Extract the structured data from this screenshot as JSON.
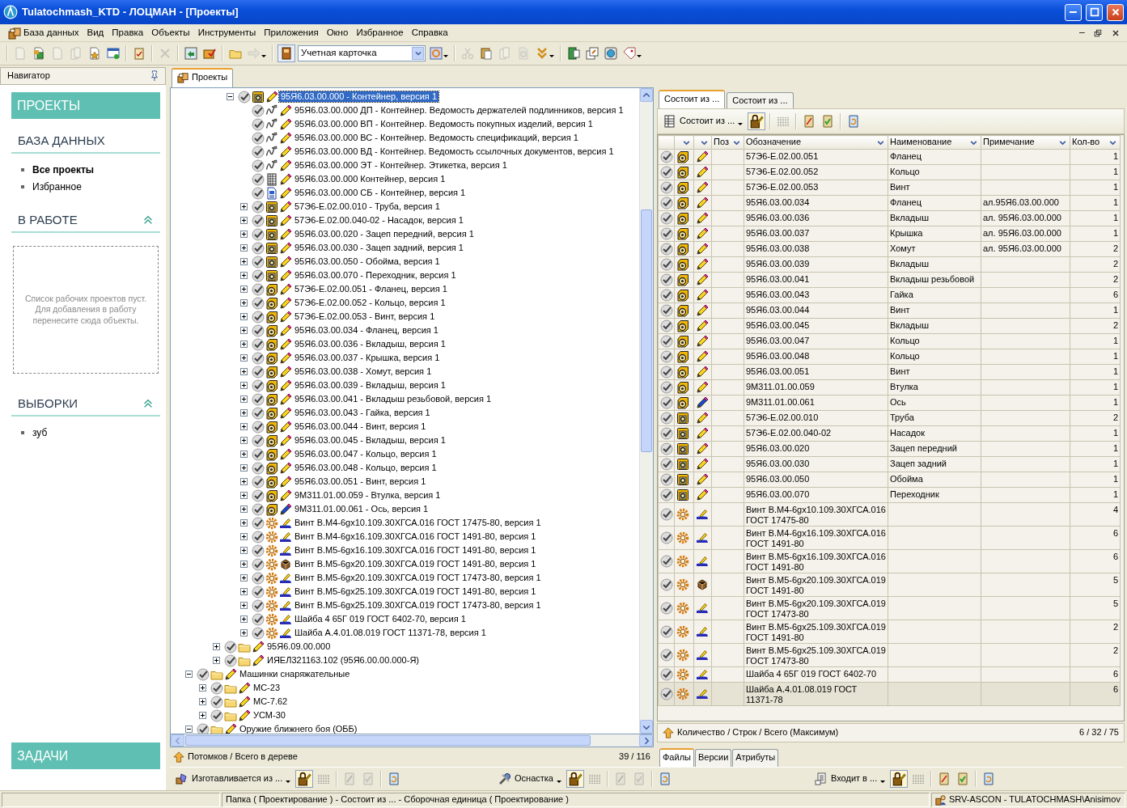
{
  "window": {
    "title": "Tulatochmash_KTD - ЛОЦМАН - [Проекты]"
  },
  "menu": [
    {
      "label": "База данных",
      "kind": "with-icon"
    },
    {
      "label": "Вид",
      "kind": "plain"
    },
    {
      "label": "Правка",
      "kind": "plain"
    },
    {
      "label": "Объекты",
      "kind": "plain"
    },
    {
      "label": "Инструменты",
      "kind": "plain"
    },
    {
      "label": "Приложения",
      "kind": "plain"
    },
    {
      "label": "Окно",
      "kind": "plain"
    },
    {
      "label": "Избранное",
      "kind": "plain"
    },
    {
      "label": "Справка",
      "kind": "plain"
    }
  ],
  "toolbar": [
    {
      "kind": "page",
      "disabled": true
    },
    {
      "kind": "pagecolor",
      "disabled": false
    },
    {
      "kind": "page",
      "disabled": true
    },
    {
      "kind": "pages",
      "disabled": true
    },
    {
      "kind": "geardoc",
      "disabled": false
    },
    {
      "kind": "winplus",
      "disabled": false
    },
    {
      "kind": "separator"
    },
    {
      "kind": "clip",
      "disabled": false
    },
    {
      "kind": "separator"
    },
    {
      "kind": "x",
      "disabled": true
    },
    {
      "kind": "separator"
    },
    {
      "kind": "imgarrow",
      "disabled": false
    },
    {
      "kind": "gearcheck",
      "disabled": false
    },
    {
      "kind": "separator"
    },
    {
      "kind": "folder",
      "disabled": false
    },
    {
      "kind": "go",
      "disabled": true,
      "dropdown": true
    },
    {
      "kind": "separator"
    },
    {
      "kind": "book",
      "disabled": false
    },
    {
      "kind": "combo",
      "value": "Учетная карточка"
    },
    {
      "kind": "cardrefresh",
      "disabled": false,
      "dropdown": true
    },
    {
      "kind": "separator"
    },
    {
      "kind": "scissors",
      "disabled": true
    },
    {
      "kind": "paste",
      "disabled": false
    },
    {
      "kind": "pages",
      "disabled": true
    },
    {
      "kind": "docsearch",
      "disabled": true
    },
    {
      "kind": "chevrons",
      "disabled": false,
      "dropdown": true
    },
    {
      "kind": "separator"
    },
    {
      "kind": "greendoor",
      "disabled": false
    },
    {
      "kind": "windows",
      "disabled": false
    },
    {
      "kind": "globe",
      "disabled": false
    },
    {
      "kind": "tag",
      "disabled": false,
      "dropdown": true
    }
  ],
  "navigator": {
    "title": "Навигатор",
    "sections": [
      {
        "kind": "banner",
        "title": "ПРОЕКТЫ"
      },
      {
        "kind": "heading",
        "title": "БАЗА ДАННЫХ",
        "collapsible": false,
        "items": [
          {
            "label": "Все проекты",
            "selected": true
          },
          {
            "label": "Избранное",
            "selected": false
          }
        ]
      },
      {
        "kind": "heading",
        "title": "В РАБОТЕ",
        "collapsible": true,
        "empty_text": "Список рабочих проектов пуст. Для добавления в работу перенесите сюда объекты."
      },
      {
        "kind": "heading",
        "title": "ВЫБОРКИ",
        "collapsible": true,
        "items": [
          {
            "label": "зуб",
            "selected": false
          }
        ]
      }
    ],
    "footer": "ЗАДАЧИ"
  },
  "tree": {
    "tabs": [
      {
        "label": "Проекты",
        "selected": true
      }
    ],
    "items": [
      {
        "children": [
          {
            "children": [
              {
                "children": [
                  {
                    "label": "95Я6.03.00.000 - Контейнер, версия 1",
                    "kind": "asm",
                    "expanded": true,
                    "selected": true,
                    "children": [
                      {
                        "label": "95Я6.03.00.000 ДП - Контейнер. Ведомость держателей подлинников, версия 1",
                        "kind": "sig",
                        "selected": false
                      },
                      {
                        "label": "95Я6.03.00.000 ВП - Контейнер. Ведомость покупных изделий, версия 1",
                        "kind": "sig",
                        "selected": false
                      },
                      {
                        "label": "95Я6.03.00.000 ВС - Контейнер. Ведомость спецификаций, версия 1",
                        "kind": "sig",
                        "selected": false
                      },
                      {
                        "label": "95Я6.03.00.000 ВД - Контейнер. Ведомость ссылочных документов, версия 1",
                        "kind": "sig",
                        "selected": false
                      },
                      {
                        "label": "95Я6.03.00.000 ЭТ - Контейнер. Этикетка, версия 1",
                        "kind": "sig",
                        "selected": false
                      },
                      {
                        "label": "95Я6.03.00.000 Контейнер, версия 1",
                        "kind": "spec",
                        "selected": false
                      },
                      {
                        "label": "95Я6.03.00.000 СБ - Контейнер, версия 1",
                        "kind": "drawing",
                        "selected": false
                      },
                      {
                        "label": "57Э6-Е.02.00.010 - Труба, версия 1",
                        "kind": "asm",
                        "expanded": false,
                        "selected": false
                      },
                      {
                        "label": "57Э6-Е.02.00.040-02 - Насадок, версия 1",
                        "kind": "asm",
                        "expanded": false,
                        "selected": false
                      },
                      {
                        "label": "95Я6.03.00.020 - Зацеп передний, версия 1",
                        "kind": "asm",
                        "expanded": false,
                        "selected": false
                      },
                      {
                        "label": "95Я6.03.00.030 - Зацеп задний, версия 1",
                        "kind": "asm",
                        "expanded": false,
                        "selected": false
                      },
                      {
                        "label": "95Я6.03.00.050 - Обойма, версия 1",
                        "kind": "asm",
                        "expanded": false,
                        "selected": false
                      },
                      {
                        "label": "95Я6.03.00.070 - Переходник, версия 1",
                        "kind": "asm",
                        "expanded": false,
                        "selected": false
                      },
                      {
                        "label": "57Э6-Е.02.00.051 - Фланец, версия 1",
                        "kind": "part",
                        "expanded": false,
                        "selected": false
                      },
                      {
                        "label": "57Э6-Е.02.00.052 - Кольцо, версия 1",
                        "kind": "part",
                        "expanded": false,
                        "selected": false
                      },
                      {
                        "label": "57Э6-Е.02.00.053 - Винт, версия 1",
                        "kind": "part",
                        "expanded": false,
                        "selected": false
                      },
                      {
                        "label": "95Я6.03.00.034 - Фланец, версия 1",
                        "kind": "part",
                        "expanded": false,
                        "selected": false
                      },
                      {
                        "label": "95Я6.03.00.036 - Вкладыш, версия 1",
                        "kind": "part",
                        "expanded": false,
                        "selected": false
                      },
                      {
                        "label": "95Я6.03.00.037 - Крышка, версия 1",
                        "kind": "part",
                        "expanded": false,
                        "selected": false
                      },
                      {
                        "label": "95Я6.03.00.038 - Хомут, версия 1",
                        "kind": "part",
                        "expanded": false,
                        "selected": false
                      },
                      {
                        "label": "95Я6.03.00.039 - Вкладыш, версия 1",
                        "kind": "part",
                        "expanded": false,
                        "selected": false
                      },
                      {
                        "label": "95Я6.03.00.041 - Вкладыш резьбовой, версия 1",
                        "kind": "part",
                        "expanded": false,
                        "selected": false
                      },
                      {
                        "label": "95Я6.03.00.043 - Гайка, версия 1",
                        "kind": "part",
                        "expanded": false,
                        "selected": false
                      },
                      {
                        "label": "95Я6.03.00.044 - Винт, версия 1",
                        "kind": "part",
                        "expanded": false,
                        "selected": false
                      },
                      {
                        "label": "95Я6.03.00.045 - Вкладыш, версия 1",
                        "kind": "part",
                        "expanded": false,
                        "selected": false
                      },
                      {
                        "label": "95Я6.03.00.047 - Кольцо, версия 1",
                        "kind": "part",
                        "expanded": false,
                        "selected": false
                      },
                      {
                        "label": "95Я6.03.00.048 - Кольцо, версия 1",
                        "kind": "part",
                        "expanded": false,
                        "selected": false
                      },
                      {
                        "label": "95Я6.03.00.051 - Винт, версия 1",
                        "kind": "part",
                        "expanded": false,
                        "selected": false
                      },
                      {
                        "label": "9М311.01.00.059 - Втулка, версия 1",
                        "kind": "part",
                        "expanded": false,
                        "selected": false
                      },
                      {
                        "label": "9М311.01.00.061 - Ось, версия 1",
                        "kind": "part-blue",
                        "expanded": false,
                        "selected": false
                      },
                      {
                        "label": "Винт В.М4-6gx10.109.30ХГСА.016 ГОСТ 17475-80, версия 1",
                        "kind": "std",
                        "expanded": false,
                        "selected": false
                      },
                      {
                        "label": "Винт В.М4-6gx16.109.30ХГСА.016 ГОСТ 1491-80, версия 1",
                        "kind": "std",
                        "expanded": false,
                        "selected": false
                      },
                      {
                        "label": "Винт В.М5-6gx16.109.30ХГСА.016 ГОСТ 1491-80, версия 1",
                        "kind": "std",
                        "expanded": false,
                        "selected": false
                      },
                      {
                        "label": "Винт В.М5-6gx20.109.30ХГСА.019 ГОСТ 1491-80, версия 1",
                        "kind": "std-cube",
                        "expanded": false,
                        "selected": false
                      },
                      {
                        "label": "Винт В.М5-6gx20.109.30ХГСА.019 ГОСТ 17473-80, версия 1",
                        "kind": "std",
                        "expanded": false,
                        "selected": false
                      },
                      {
                        "label": "Винт В.М5-6gx25.109.30ХГСА.019 ГОСТ 1491-80, версия 1",
                        "kind": "std",
                        "expanded": false,
                        "selected": false
                      },
                      {
                        "label": "Винт В.М5-6gx25.109.30ХГСА.019 ГОСТ 17473-80, версия 1",
                        "kind": "std",
                        "expanded": false,
                        "selected": false
                      },
                      {
                        "label": "Шайба 4 65Г 019 ГОСТ 6402-70, версия 1",
                        "kind": "std",
                        "expanded": false,
                        "selected": false
                      },
                      {
                        "label": "Шайба А.4.01.08.019 ГОСТ 11371-78, версия 1",
                        "kind": "std",
                        "expanded": false,
                        "selected": false
                      }
                    ]
                  }
                ]
              },
              {
                "label": "95Я6.09.00.000",
                "kind": "folder",
                "expanded": false,
                "selected": false
              },
              {
                "label": "ИЯЕЛ321163.102 (95Я6.00.00.000-Я)",
                "kind": "folder",
                "expanded": false,
                "selected": false
              }
            ]
          }
        ]
      },
      {
        "label": "Машинки снаряжательные",
        "kind": "folder",
        "expanded": true,
        "selected": false,
        "children": [
          {
            "label": "МС-23",
            "kind": "folder",
            "expanded": false,
            "selected": false
          },
          {
            "label": "МС-7.62",
            "kind": "folder",
            "expanded": false,
            "selected": false
          },
          {
            "label": "УСМ-30",
            "kind": "folder",
            "expanded": false,
            "selected": false
          }
        ]
      },
      {
        "label": "Оружие ближнего боя (ОББ)",
        "kind": "folder",
        "expanded": true,
        "selected": false
      }
    ],
    "status": {
      "label": "Потомков / Всего в дереве",
      "value": "39 / 116"
    }
  },
  "composition": {
    "tabs": [
      {
        "label": "Состоит из ...",
        "selected": true
      },
      {
        "label": "Состоит из ...",
        "selected": false
      }
    ],
    "view_button": "Состоит из ...",
    "columns": [
      "Поз",
      "Обозначение",
      "Наименование",
      "Примечание",
      "Кол-во"
    ],
    "rows": [
      {
        "kind": "part",
        "designation": "57Э6-Е.02.00.051",
        "name": "Фланец",
        "qty": "1",
        "selected": false
      },
      {
        "kind": "part",
        "designation": "57Э6-Е.02.00.052",
        "name": "Кольцо",
        "qty": "1",
        "selected": false
      },
      {
        "kind": "part",
        "designation": "57Э6-Е.02.00.053",
        "name": "Винт",
        "qty": "1",
        "selected": false
      },
      {
        "kind": "part",
        "designation": "95Я6.03.00.034",
        "name": "Фланец",
        "note": "ал.95Я6.03.00.000",
        "qty": "1",
        "selected": false
      },
      {
        "kind": "part",
        "designation": "95Я6.03.00.036",
        "name": "Вкладыш",
        "note": "ал. 95Я6.03.00.000",
        "qty": "1",
        "selected": false
      },
      {
        "kind": "part",
        "designation": "95Я6.03.00.037",
        "name": "Крышка",
        "note": "ал. 95Я6.03.00.000",
        "qty": "1",
        "selected": false
      },
      {
        "kind": "part",
        "designation": "95Я6.03.00.038",
        "name": "Хомут",
        "note": "ал. 95Я6.03.00.000",
        "qty": "2",
        "selected": false
      },
      {
        "kind": "part",
        "designation": "95Я6.03.00.039",
        "name": "Вкладыш",
        "qty": "2",
        "selected": false
      },
      {
        "kind": "part",
        "designation": "95Я6.03.00.041",
        "name": "Вкладыш резьбовой",
        "qty": "2",
        "selected": false
      },
      {
        "kind": "part",
        "designation": "95Я6.03.00.043",
        "name": "Гайка",
        "qty": "6",
        "selected": false
      },
      {
        "kind": "part",
        "designation": "95Я6.03.00.044",
        "name": "Винт",
        "qty": "1",
        "selected": false
      },
      {
        "kind": "part",
        "designation": "95Я6.03.00.045",
        "name": "Вкладыш",
        "qty": "2",
        "selected": false
      },
      {
        "kind": "part",
        "designation": "95Я6.03.00.047",
        "name": "Кольцо",
        "qty": "1",
        "selected": false
      },
      {
        "kind": "part",
        "designation": "95Я6.03.00.048",
        "name": "Кольцо",
        "qty": "1",
        "selected": false
      },
      {
        "kind": "part",
        "designation": "95Я6.03.00.051",
        "name": "Винт",
        "qty": "1",
        "selected": false
      },
      {
        "kind": "part",
        "designation": "9М311.01.00.059",
        "name": "Втулка",
        "qty": "1",
        "selected": false
      },
      {
        "kind": "part-blue",
        "designation": "9М311.01.00.061",
        "name": "Ось",
        "qty": "1",
        "selected": false
      },
      {
        "kind": "asm",
        "designation": "57Э6-Е.02.00.010",
        "name": "Труба",
        "qty": "2",
        "selected": false
      },
      {
        "kind": "asm",
        "designation": "57Э6-Е.02.00.040-02",
        "name": "Насадок",
        "qty": "1",
        "selected": false
      },
      {
        "kind": "asm",
        "designation": "95Я6.03.00.020",
        "name": "Зацеп передний",
        "qty": "1",
        "selected": false
      },
      {
        "kind": "asm",
        "designation": "95Я6.03.00.030",
        "name": "Зацеп задний",
        "qty": "1",
        "selected": false
      },
      {
        "kind": "asm",
        "designation": "95Я6.03.00.050",
        "name": "Обойма",
        "qty": "1",
        "selected": false
      },
      {
        "kind": "asm",
        "designation": "95Я6.03.00.070",
        "name": "Переходник",
        "qty": "1",
        "selected": false
      },
      {
        "kind": "std",
        "designation": "Винт В.М4-6gx10.109.30ХГСА.016 ГОСТ 17475-80",
        "qty": "4",
        "selected": false
      },
      {
        "kind": "std",
        "designation": "Винт В.М4-6gx16.109.30ХГСА.016 ГОСТ 1491-80",
        "qty": "6",
        "selected": false
      },
      {
        "kind": "std",
        "designation": "Винт В.М5-6gx16.109.30ХГСА.016 ГОСТ 1491-80",
        "qty": "6",
        "selected": false
      },
      {
        "kind": "std-cube",
        "designation": "Винт В.М5-6gx20.109.30ХГСА.019 ГОСТ 1491-80",
        "qty": "5",
        "selected": false
      },
      {
        "kind": "std",
        "designation": "Винт В.М5-6gx20.109.30ХГСА.019 ГОСТ 17473-80",
        "qty": "5",
        "selected": false
      },
      {
        "kind": "std",
        "designation": "Винт В.М5-6gx25.109.30ХГСА.019 ГОСТ 1491-80",
        "qty": "2",
        "selected": false
      },
      {
        "kind": "std",
        "designation": "Винт В.М5-6gx25.109.30ХГСА.019 ГОСТ 17473-80",
        "qty": "2",
        "selected": false
      },
      {
        "kind": "std",
        "designation": "Шайба 4 65Г 019 ГОСТ 6402-70",
        "qty": "6",
        "selected": false
      },
      {
        "kind": "std",
        "designation": "Шайба А.4.01.08.019 ГОСТ 11371-78",
        "qty": "6",
        "selected": true
      }
    ],
    "footer": {
      "label": "Количество / Строк / Всего (Максимум)",
      "value": "6 / 32 / 75"
    },
    "bottom_tabs": [
      {
        "label": "Файлы",
        "selected": true
      },
      {
        "label": "Версии",
        "selected": false
      },
      {
        "label": "Атрибуты",
        "selected": false
      }
    ]
  },
  "relation_toolbars": [
    {
      "kind": "boxes",
      "label": "Изготавливается из ...",
      "actions_disabled": true
    },
    {
      "kind": "tools",
      "label": "Оснастка",
      "actions_disabled": true
    },
    {
      "kind": "stack",
      "label": "Входит в ...",
      "actions_disabled": false
    }
  ],
  "status_bar": {
    "text": "Папка ( Проектирование ) - Состоит из ... - Сборочная единица ( Проектирование )",
    "user": "SRV-ASCON - TULATOCHMASH\\Anisimov"
  }
}
